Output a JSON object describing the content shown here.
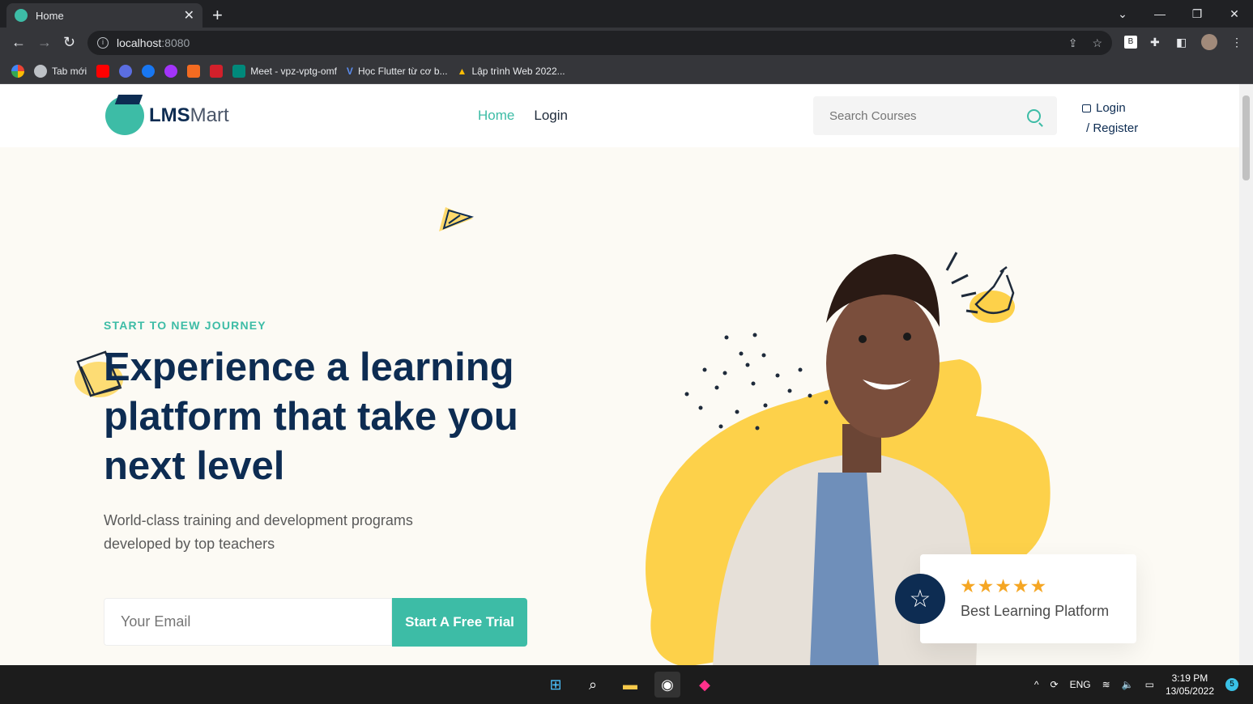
{
  "browser": {
    "tab_title": "Home",
    "url_host": "localhost",
    "url_port": ":8080",
    "bookmarks": [
      "Tab mới",
      "Meet - vpz-vptg-omf",
      "Học Flutter từ cơ b...",
      "Lập trình Web 2022..."
    ]
  },
  "site": {
    "logo_bold": "LMS",
    "logo_light": "Mart",
    "nav": {
      "home": "Home",
      "login": "Login"
    },
    "search_placeholder": "Search Courses",
    "auth": {
      "login": "Login",
      "register": "/ Register"
    }
  },
  "hero": {
    "subtitle": "START TO NEW JOURNEY",
    "title": "Experience a learning platform that take you next level",
    "description": "World-class training and development programs developed by top teachers",
    "email_placeholder": "Your Email",
    "cta": "Start A Free Trial"
  },
  "card": {
    "stars": "★★★★★",
    "rating": 5,
    "label": "Best Learning Platform"
  },
  "taskbar": {
    "language": "ENG",
    "time": "3:19 PM",
    "date": "13/05/2022",
    "notifications": "5"
  },
  "colors": {
    "accent": "#3dbca6",
    "navy": "#0d2c52",
    "yellow": "#fdd14a",
    "star": "#f5a623"
  }
}
